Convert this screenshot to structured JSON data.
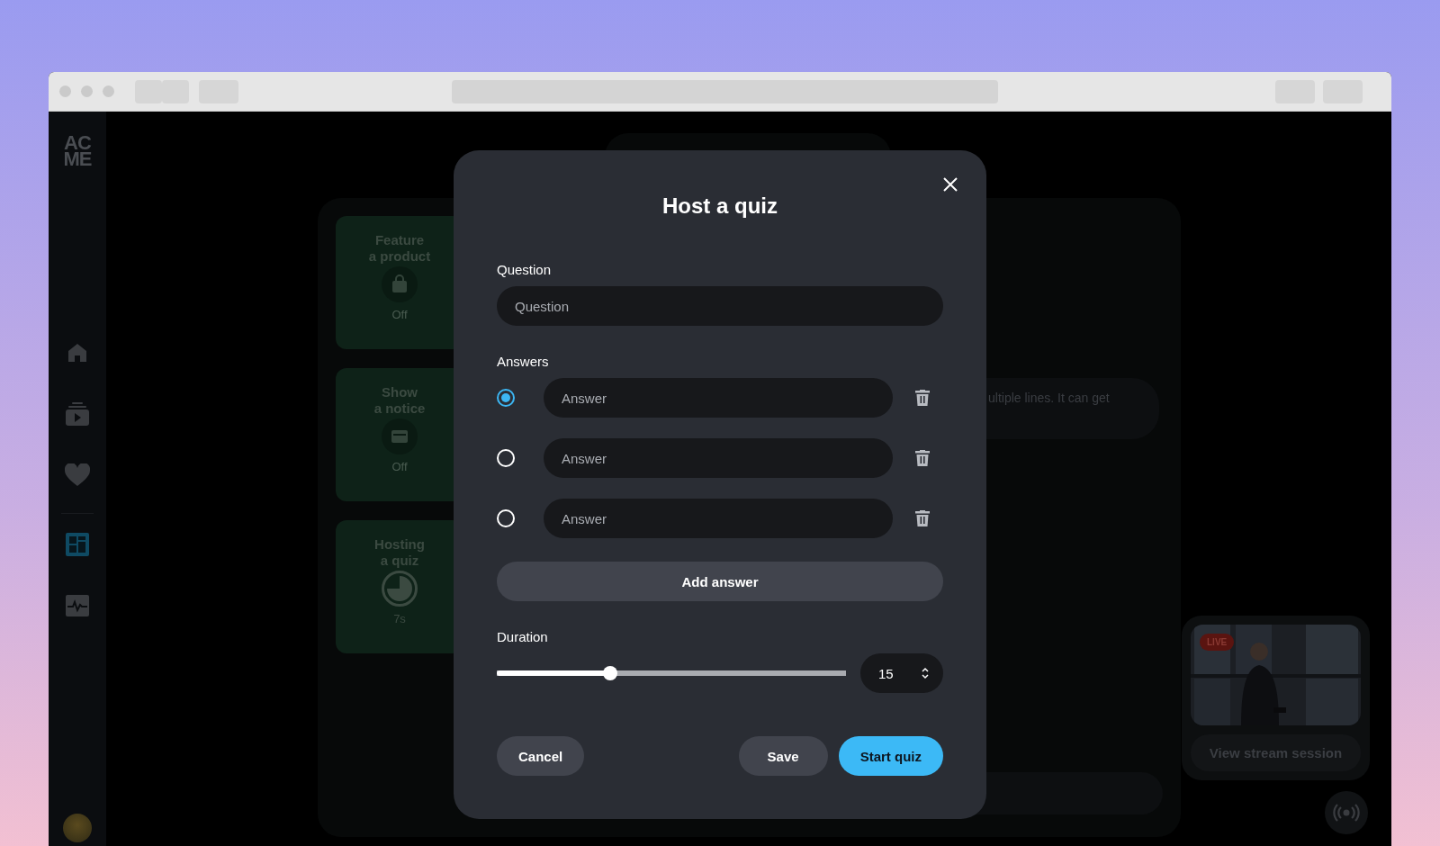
{
  "sidebar": {
    "logo_lines": [
      "AC",
      "ME"
    ],
    "items": [
      {
        "kind": "home",
        "selected": false
      },
      {
        "kind": "video",
        "selected": false
      },
      {
        "kind": "heart",
        "selected": false
      },
      {
        "kind": "dashboard",
        "selected": true
      },
      {
        "kind": "activity",
        "selected": false
      }
    ]
  },
  "cards": [
    {
      "title_lines": [
        "Feature",
        "a product"
      ],
      "kind": "bag",
      "status": "Off"
    },
    {
      "title_lines": [
        "Show",
        "a notice"
      ],
      "kind": "notice",
      "status": "Off"
    },
    {
      "title_lines": [
        "Hosting",
        "a quiz"
      ],
      "kind": "timer",
      "status": "7s"
    }
  ],
  "chat": {
    "text": "ultiple lines. It can get"
  },
  "modal": {
    "title": "Host a quiz",
    "question": {
      "label": "Question",
      "placeholder": "Question"
    },
    "answers_label": "Answers",
    "answers": [
      {
        "placeholder": "Answer",
        "selected": true
      },
      {
        "placeholder": "Answer",
        "selected": false
      },
      {
        "placeholder": "Answer",
        "selected": false
      }
    ],
    "add_button": "Add answer",
    "duration": {
      "label": "Duration",
      "level": 0.325,
      "value": "15"
    },
    "buttons": [
      {
        "label": "Cancel",
        "kind": "secondary"
      },
      {
        "label": "Save",
        "kind": "secondary"
      },
      {
        "label": "Start quiz",
        "kind": "primary"
      }
    ]
  },
  "stream": {
    "badge": "LIVE",
    "button": "View stream session"
  }
}
